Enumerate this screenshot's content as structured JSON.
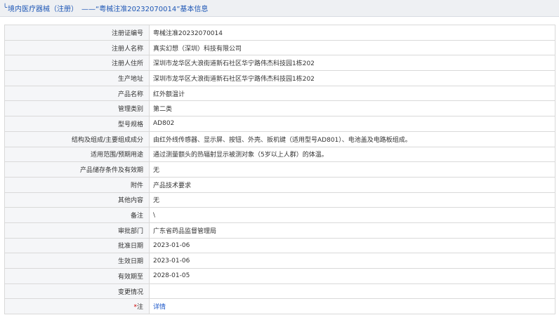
{
  "header": {
    "prefix": "╰",
    "title": "境内医疗器械（注册）　——“粤械注准20232070014”基本信息"
  },
  "rows": [
    {
      "label": "注册证编号",
      "value": "粤械注准20232070014"
    },
    {
      "label": "注册人名称",
      "value": "真实幻想（深圳）科技有限公司"
    },
    {
      "label": "注册人住所",
      "value": "深圳市龙华区大浪街道新石社区华宁路伟杰科技园1栋202"
    },
    {
      "label": "生产地址",
      "value": "深圳市龙华区大浪街道新石社区华宁路伟杰科技园1栋202"
    },
    {
      "label": "产品名称",
      "value": "红外额温计"
    },
    {
      "label": "管理类别",
      "value": "第二类"
    },
    {
      "label": "型号规格",
      "value": "AD802"
    },
    {
      "label": "结构及组成/主要组成成分",
      "value": "由红外线传感器、显示屏、按钮、外壳、扳机键（适用型号AD801）、电池盖及电路板组成。"
    },
    {
      "label": "适用范围/预期用途",
      "value": "通过测量额头的热辐射显示被测对象（5岁以上人群）的体温。"
    },
    {
      "label": "产品储存条件及有效期",
      "value": "无"
    },
    {
      "label": "附件",
      "value": "产品技术要求"
    },
    {
      "label": "其他内容",
      "value": "无"
    },
    {
      "label": "备注",
      "value": "\\"
    },
    {
      "label": "审批部门",
      "value": "广东省药品监督管理局"
    },
    {
      "label": "批准日期",
      "value": "2023-01-06"
    },
    {
      "label": "生效日期",
      "value": "2023-01-06"
    },
    {
      "label": "有效期至",
      "value": "2028-01-05"
    },
    {
      "label": "变更情况",
      "value": ""
    }
  ],
  "note_row": {
    "star": "*",
    "label": "注",
    "link": "详情"
  }
}
